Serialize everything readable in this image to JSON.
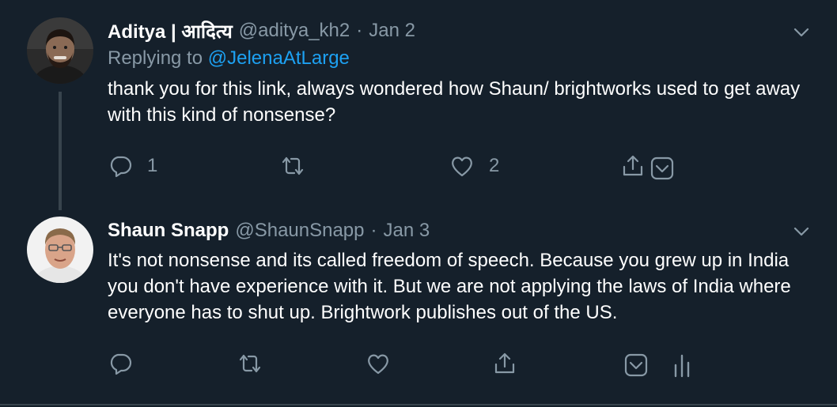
{
  "colors": {
    "background": "#15202b",
    "text_primary": "#ffffff",
    "text_secondary": "#8899a6",
    "link": "#1da1f2",
    "divider": "#38444d"
  },
  "tweets": [
    {
      "display_name": "Aditya | आदित्य",
      "handle": "@aditya_kh2",
      "separator": "·",
      "date": "Jan 2",
      "replying_to_prefix": "Replying to",
      "replying_to_handle": "@JelenaAtLarge",
      "text": "thank you for this link, always wondered how Shaun/ brightworks used to get away with this kind of nonsense?",
      "avatar_icon": "user-avatar-bearded-man",
      "actions": {
        "reply": {
          "icon": "reply-icon",
          "count": "1"
        },
        "retweet": {
          "icon": "retweet-icon",
          "count": ""
        },
        "like": {
          "icon": "heart-icon",
          "count": "2"
        },
        "share": {
          "icon": "share-icon"
        },
        "bookmark": {
          "icon": "bookmark-icon"
        }
      }
    },
    {
      "display_name": "Shaun Snapp",
      "handle": "@ShaunSnapp",
      "separator": "·",
      "date": "Jan 3",
      "text": "It's not nonsense and its called freedom of speech. Because you grew up in India you don't have experience with it. But we are not applying the laws of India where everyone has to shut up. Brightwork publishes out of the US.",
      "avatar_icon": "user-avatar-man-glasses",
      "actions": {
        "reply": {
          "icon": "reply-icon"
        },
        "retweet": {
          "icon": "retweet-icon"
        },
        "like": {
          "icon": "heart-icon"
        },
        "share": {
          "icon": "share-icon"
        },
        "bookmark": {
          "icon": "bookmark-icon"
        },
        "analytics": {
          "icon": "analytics-icon"
        }
      }
    }
  ]
}
